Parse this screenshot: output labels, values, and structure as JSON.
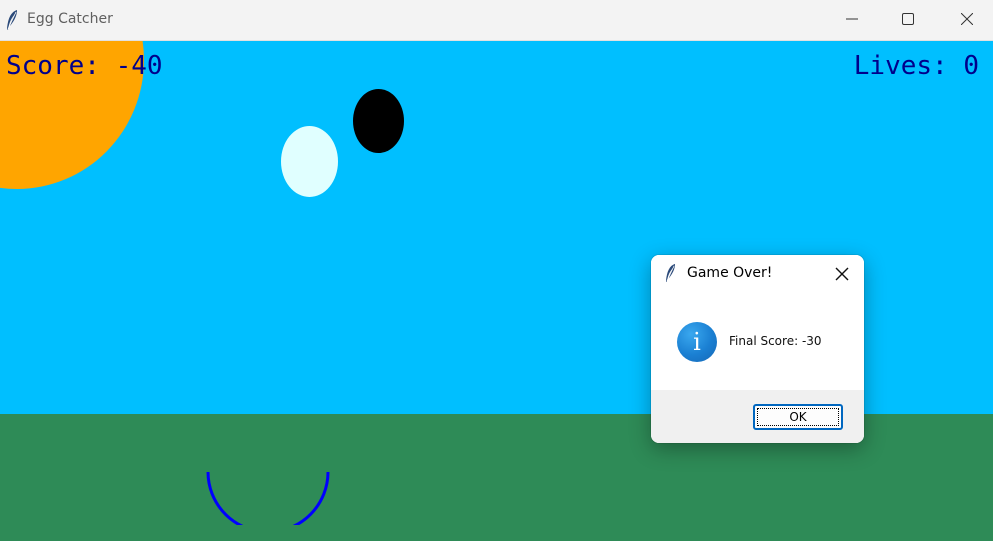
{
  "window": {
    "title": "Egg Catcher",
    "icon": "feather-icon",
    "controls": [
      "minimize-icon",
      "maximize-icon",
      "close-icon"
    ]
  },
  "game": {
    "score_text": "Score: -40",
    "lives_text": "Lives: 0",
    "colors": {
      "sky": "#00bfff",
      "grass": "#2e8b57",
      "sun": "#ffa500",
      "egg_light": "#e0ffff",
      "egg_dark": "#000000",
      "catcher": "#0000ff",
      "hud_text": "#00008b"
    }
  },
  "dialog": {
    "title": "Game Over!",
    "icon": "info-icon",
    "message": "Final Score: -30",
    "ok_label": "OK",
    "accent": "#0067c0"
  }
}
